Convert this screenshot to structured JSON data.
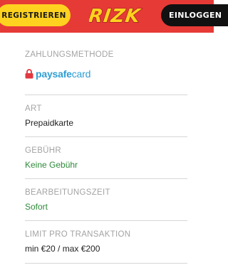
{
  "header": {
    "register_label": "REGISTRIEREN",
    "logo_text": "RIZK",
    "login_label": "EINLOGGEN"
  },
  "payment": {
    "method_label": "ZAHLUNGSMETHODE",
    "method_logo": {
      "part1": "paysafe",
      "part2": "card"
    },
    "type_label": "ART",
    "type_value": "Prepaidkarte",
    "fee_label": "GEBÜHR",
    "fee_value": "Keine Gebühr",
    "processing_label": "BEARBEITUNGSZEIT",
    "processing_value": "Sofort",
    "limit_label": "LIMIT PRO TRANSAKTION",
    "limit_value": "min €20 / max €200"
  },
  "colors": {
    "header_bg": "#e63a36",
    "register_bg": "#ffd21f",
    "login_bg": "#111111",
    "label": "#a3a3a3",
    "green_value": "#2e8a3a",
    "paysafe_blue": "#2f9fd3",
    "paysafe_red": "#e2383f"
  }
}
